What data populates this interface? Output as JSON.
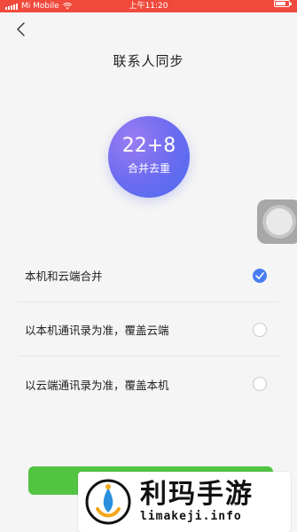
{
  "status_bar": {
    "carrier": "Mi Mobile",
    "time": "上午11:20"
  },
  "header": {
    "title": "联系人同步"
  },
  "summary": {
    "count": "22+8",
    "subtitle": "合并去重"
  },
  "options": [
    {
      "label": "本机和云端合并",
      "selected": true
    },
    {
      "label": "以本机通讯录为准，覆盖云端",
      "selected": false
    },
    {
      "label": "以云端通讯录为准，覆盖本机",
      "selected": false
    }
  ],
  "colors": {
    "status_bar": "#f04a3c",
    "accent_blue": "#4a7cf4",
    "confirm_green": "#52c442"
  },
  "watermark": {
    "title": "利玛手游",
    "url": "limakeji.info"
  }
}
